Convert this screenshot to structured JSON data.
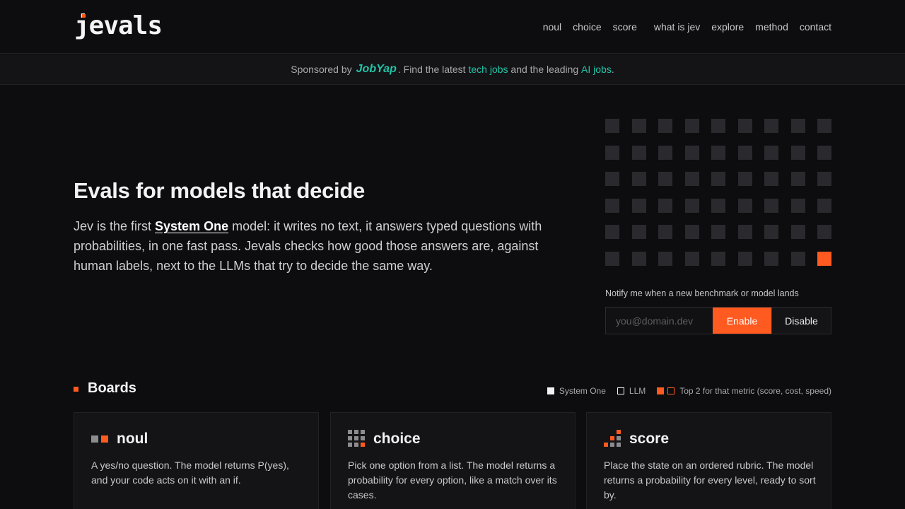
{
  "header": {
    "logo": "jevals",
    "nav": [
      {
        "label": "noul"
      },
      {
        "label": "choice"
      },
      {
        "label": "score"
      },
      {
        "label": "what is jev"
      },
      {
        "label": "explore"
      },
      {
        "label": "method"
      },
      {
        "label": "contact"
      }
    ]
  },
  "sponsor": {
    "prefix": "Sponsored by",
    "brand": "JobYap",
    "text1": ". Find the latest ",
    "link1": "tech jobs",
    "text2": " and the leading ",
    "link2": "AI jobs",
    "text3": "."
  },
  "hero": {
    "title": "Evals for models that decide",
    "text_before": "Jev is the first ",
    "text_strong": "System One",
    "text_after": " model: it writes no text, it answers typed questions with probabilities, in one fast pass. Jevals checks how good those answers are, against human labels, next to the LLMs that try to decide the same way."
  },
  "notify": {
    "label": "Notify me when a new benchmark or model lands",
    "placeholder": "you@domain.dev",
    "enable": "Enable",
    "disable": "Disable"
  },
  "boards": {
    "title": "Boards",
    "legend": {
      "system_one": "System One",
      "llm": "LLM",
      "top2": "Top 2 for that metric (score, cost, speed)"
    },
    "cards": [
      {
        "title": "noul",
        "desc": "A yes/no question. The model returns P(yes), and your code acts on it with an if."
      },
      {
        "title": "choice",
        "desc": "Pick one option from a list. The model returns a probability for every option, like a match over its cases."
      },
      {
        "title": "score",
        "desc": "Place the state on an ordered rubric. The model returns a probability for every level, ready to sort by."
      }
    ]
  },
  "colors": {
    "accent": "#ff5a1f",
    "sponsor": "#22c5a8",
    "background": "#0d0d0f"
  }
}
